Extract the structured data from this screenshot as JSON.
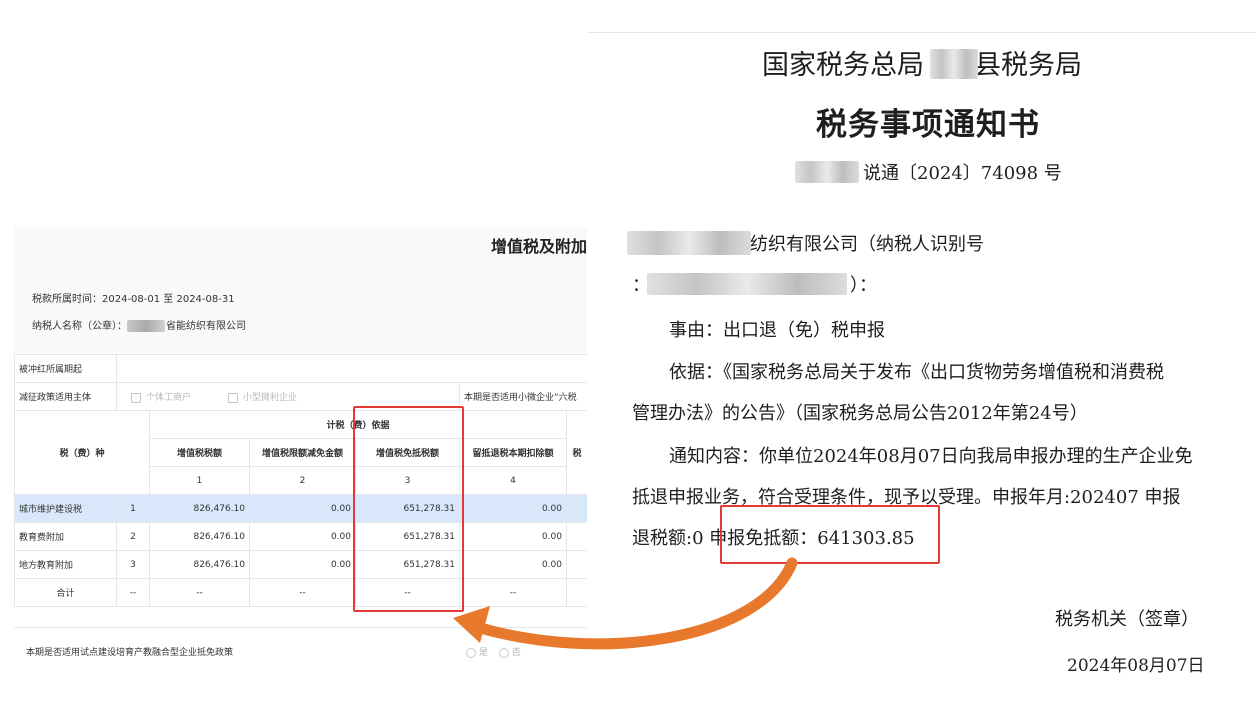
{
  "form": {
    "title": "增值税及附加",
    "period_label": "税款所属时间：",
    "period_value": "2024-08-01 至 2024-08-31",
    "taxpayer_label": "纳税人名称（公章）：",
    "taxpayer_value": "省能纺织有限公司",
    "rows": {
      "offset_period_label": "被冲红所属期起",
      "policy_subject_label": "减征政策适用主体",
      "option_individual": "个体工商户",
      "option_small_micro": "小型微利企业",
      "six_tax_note": "本期是否适用小微企业“六税",
      "basis_group_header": "计税（费）依据",
      "tax_type_header": "税（费）种",
      "partial_col_header": "税",
      "col1": "增值税税额",
      "col2": "增值税限额减免金额",
      "col3": "增值税免抵税额",
      "col4": "留抵退税本期扣除额",
      "n1": "1",
      "n2": "2",
      "n3": "3",
      "n4": "4"
    },
    "data_rows": [
      {
        "name": "城市维护建设税",
        "no": "1",
        "c1": "826,476.10",
        "c2": "0.00",
        "c3": "651,278.31",
        "c4": "0.00"
      },
      {
        "name": "教育费附加",
        "no": "2",
        "c1": "826,476.10",
        "c2": "0.00",
        "c3": "651,278.31",
        "c4": "0.00"
      },
      {
        "name": "地方教育附加",
        "no": "3",
        "c1": "826,476.10",
        "c2": "0.00",
        "c3": "651,278.31",
        "c4": "0.00"
      }
    ],
    "total": {
      "label": "合计",
      "no": "--",
      "c1": "--",
      "c2": "--",
      "c3": "--",
      "c4": "--"
    },
    "pilot_policy_label": "本期是否适用试点建设培育产教融合型企业抵免政策",
    "radio_yes": "是",
    "radio_no": "否"
  },
  "notice": {
    "agency_part1": "国家税务总局",
    "agency_part2": "县税务局",
    "title": "税务事项通知书",
    "doc_number": "说通〔2024〕74098 号",
    "recipient": "纺织有限公司（纳税人识别号",
    "taxpayer_id_prefix": "：",
    "taxpayer_id_suffix": "）：",
    "reason": "事由：出口退（免）税申报",
    "basis_line1": "依据：《国家税务总局关于发布《出口货物劳务增值税和消费税",
    "basis_line2": "管理办法》的公告》（国家税务总局公告2012年第24号）",
    "content_line1": "通知内容：你单位2024年08月07日向我局申报办理的生产企业免",
    "content_line2": "抵退申报业务，符合受理条件，现予以受理。申报年月:202407 申报",
    "content_line3": "退税额:0 申报免抵额：641303.85",
    "signature": "税务机关（签章）",
    "date": "2024年08月07日"
  },
  "colors": {
    "highlight": "#e53935",
    "arrow": "#e8782c",
    "selected_row": "#d9e7fb",
    "header_bg": "#f8f9fb"
  }
}
